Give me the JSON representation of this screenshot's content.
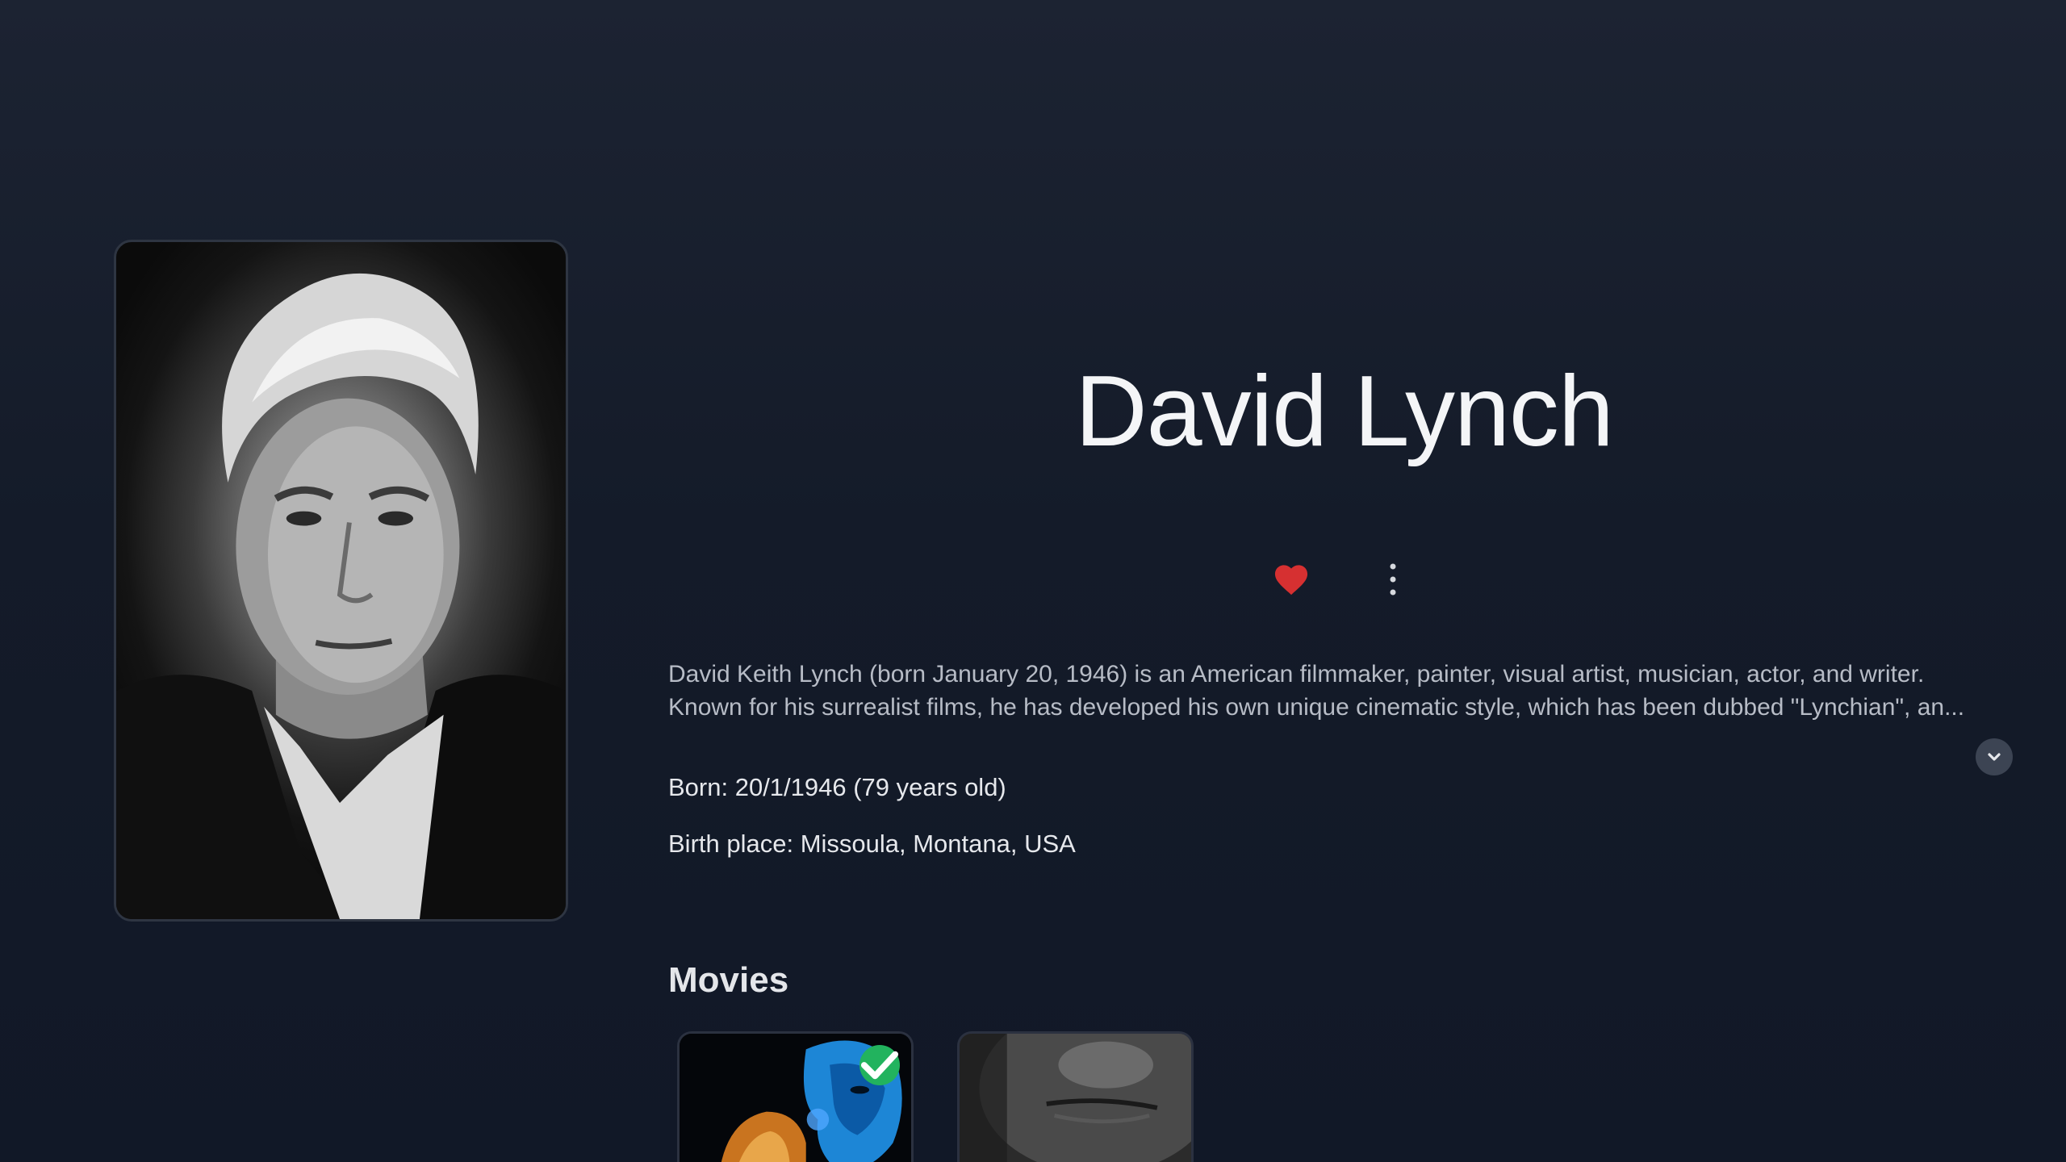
{
  "person": {
    "name": "David Lynch",
    "bio_lines": [
      "David Keith Lynch (born January 20, 1946) is an American filmmaker, painter, visual artist, musician, actor, and writer.",
      "Known for his surrealist films, he has developed his own unique cinematic style, which has been dubbed \"Lynchian\", an..."
    ],
    "born": "Born: 20/1/1946 (79 years old)",
    "birth_place": "Birth place: Missoula, Montana, USA"
  },
  "actions": {
    "favorite_icon": "heart-icon",
    "more_icon": "more-vertical-icon",
    "favorite_color": "#d63031"
  },
  "expand_icon": "chevron-down-icon",
  "movies": {
    "heading": "Movies",
    "badge_icon": "checkmark-icon",
    "badge_color": "#22b35e"
  }
}
